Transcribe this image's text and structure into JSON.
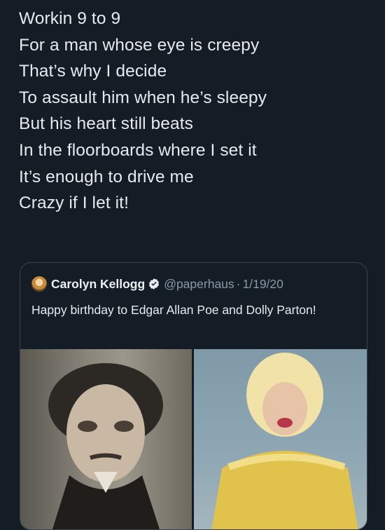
{
  "tweet": {
    "lines": [
      "Workin 9 to 9",
      "For a man whose eye is creepy",
      "That’s why I decide",
      "To assault him when he’s sleepy",
      "But his heart still beats",
      "In the floorboards where I set it",
      "It’s enough to drive me",
      "Crazy if I let it!"
    ]
  },
  "quoted_tweet": {
    "display_name": "Carolyn Kellogg",
    "handle": "@paperhaus",
    "separator": "·",
    "date": "1/19/20",
    "text": "Happy birthday to Edgar Allan Poe and Dolly Parton!",
    "verified_icon": "verified-badge-icon",
    "colors": {
      "card_border": "#38444d",
      "secondary_text": "#8899a6",
      "background": "#141d26"
    }
  }
}
